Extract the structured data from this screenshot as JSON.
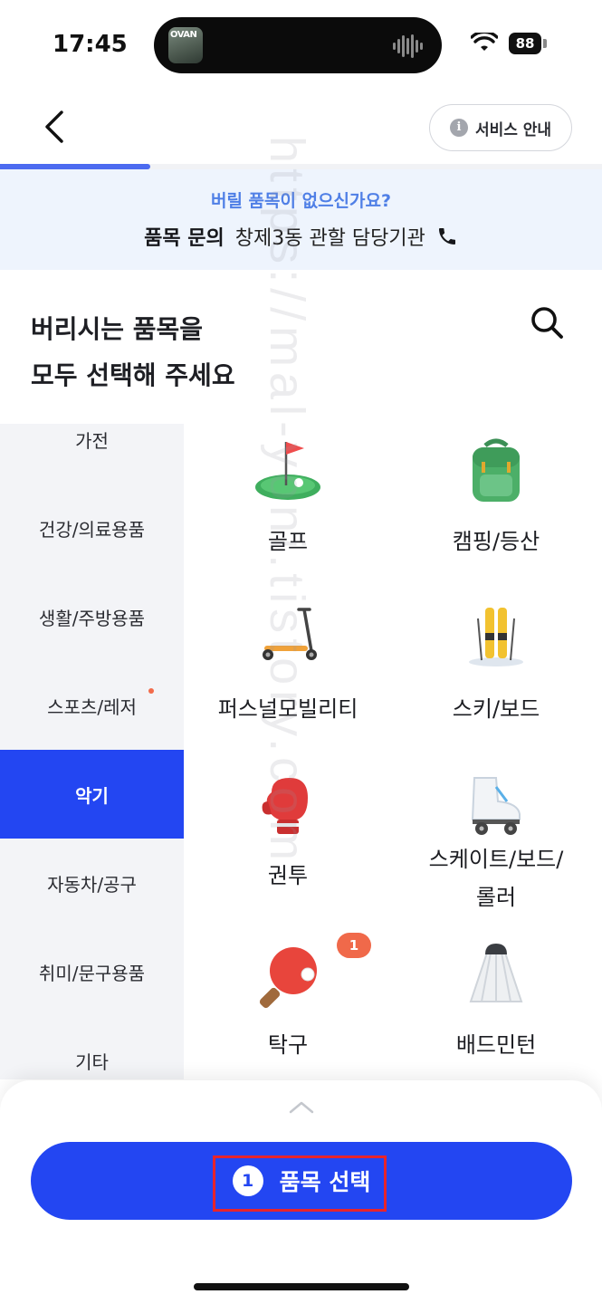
{
  "status_bar": {
    "time": "17:45",
    "battery": "88",
    "now_playing_thumb": "OVAN"
  },
  "header": {
    "service_button": "서비스 안내",
    "progress_fraction": 0.25
  },
  "banner": {
    "question": "버릴 품목이 없으신가요?",
    "inquiry_label": "품목 문의",
    "inquiry_org": "창제3동 관할 담당기관"
  },
  "title": {
    "line1": "버리시는 품목을",
    "line2": "모두 선택해 주세요"
  },
  "categories": [
    {
      "label": "가전",
      "active": false
    },
    {
      "label": "건강/의료용품",
      "active": false
    },
    {
      "label": "생활/주방용품",
      "active": false
    },
    {
      "label": "스포츠/레저",
      "active": false,
      "dot": true
    },
    {
      "label": "악기",
      "active": true
    },
    {
      "label": "자동차/공구",
      "active": false
    },
    {
      "label": "취미/문구용품",
      "active": false
    },
    {
      "label": "기타",
      "active": false
    }
  ],
  "items": [
    {
      "label": "골프",
      "icon": "golf-icon"
    },
    {
      "label": "캠핑/등산",
      "icon": "backpack-icon"
    },
    {
      "label": "퍼스널모빌리티",
      "icon": "scooter-icon"
    },
    {
      "label": "스키/보드",
      "icon": "ski-icon"
    },
    {
      "label": "권투",
      "icon": "boxing-glove-icon"
    },
    {
      "label_line1": "스케이트/보드/",
      "label_line2": "롤러",
      "icon": "roller-skate-icon"
    },
    {
      "label": "탁구",
      "icon": "ping-pong-icon",
      "badge": "1"
    },
    {
      "label": "배드민턴",
      "icon": "shuttlecock-icon"
    }
  ],
  "bottom": {
    "selected_count": "1",
    "select_label": "품목 선택"
  },
  "watermark": "https://mal-yoni.tistory.com",
  "colors": {
    "primary": "#2346f2",
    "banner_bg": "#eef4fd",
    "accent_text": "#4f7fe6",
    "badge": "#f0694a"
  }
}
